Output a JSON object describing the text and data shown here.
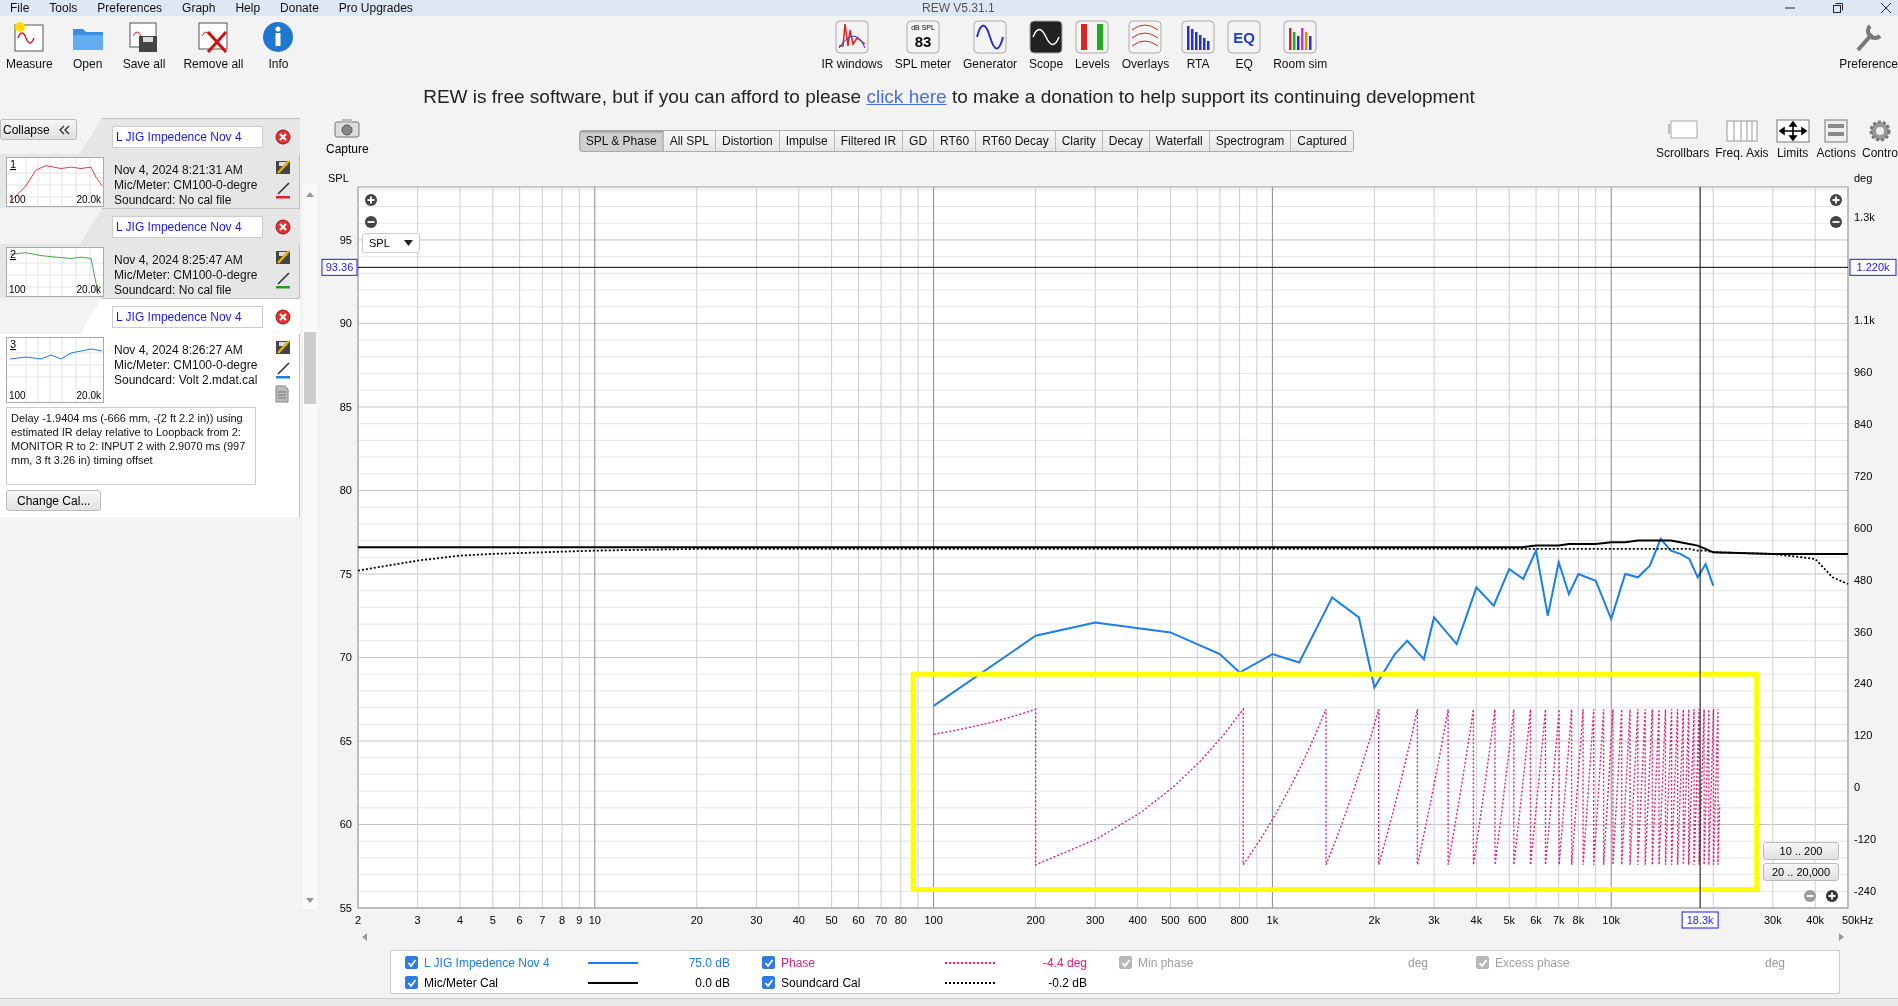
{
  "window": {
    "title": "REW V5.31.1"
  },
  "menu": [
    "File",
    "Tools",
    "Preferences",
    "Graph",
    "Help",
    "Donate",
    "Pro Upgrades"
  ],
  "toolbar_left": [
    {
      "label": "Measure",
      "kind": "measure"
    },
    {
      "label": "Open",
      "kind": "open"
    },
    {
      "label": "Save all",
      "kind": "save"
    },
    {
      "label": "Remove all",
      "kind": "remove"
    },
    {
      "label": "Info",
      "kind": "info"
    }
  ],
  "toolbar_center": [
    {
      "label": "IR windows",
      "kind": "ir"
    },
    {
      "label": "SPL meter",
      "kind": "meter",
      "badge_top": "dB SPL",
      "badge_value": "83"
    },
    {
      "label": "Generator",
      "kind": "generator"
    },
    {
      "label": "Scope",
      "kind": "scope"
    },
    {
      "label": "Levels",
      "kind": "levels"
    },
    {
      "label": "Overlays",
      "kind": "overlays"
    },
    {
      "label": "RTA",
      "kind": "rta"
    },
    {
      "label": "EQ",
      "kind": "eq",
      "badge_value": "EQ"
    },
    {
      "label": "Room sim",
      "kind": "roomsim"
    }
  ],
  "toolbar_right": [
    {
      "label": "Preference",
      "kind": "wrench"
    }
  ],
  "donation": {
    "before": "REW is free software, but if you can afford to please ",
    "link": "click here",
    "after": " to make a donation to help support its continuing development"
  },
  "panel": {
    "collapse": "Collapse",
    "measurements": [
      {
        "index": "1",
        "name": "L JIG Impedence Nov 4",
        "color": "#e02020",
        "date": "Nov 4, 2024 8:21:31 AM",
        "mic": "Mic/Meter: CM100-0-degre",
        "soundcard": "Soundcard: No cal file",
        "axis_low": "100",
        "axis_high": "20.0k",
        "selected": false,
        "expanded": false
      },
      {
        "index": "2",
        "name": "L JIG Impedence Nov 4",
        "color": "#2a9a2a",
        "date": "Nov 4, 2024 8:25:47 AM",
        "mic": "Mic/Meter: CM100-0-degre",
        "soundcard": "Soundcard: No cal file",
        "axis_low": "100",
        "axis_high": "20.0k",
        "selected": false,
        "expanded": false
      },
      {
        "index": "3",
        "name": "L JIG Impedence Nov 4",
        "color": "#1a7fe8",
        "date": "Nov 4, 2024 8:26:27 AM",
        "mic": "Mic/Meter: CM100-0-degre",
        "soundcard": "Soundcard: Volt 2.mdat.cal",
        "axis_low": "100",
        "axis_high": "20.0k",
        "selected": true,
        "expanded": true,
        "delay_info": "Delay -1.9404 ms (-666 mm, -(2 ft 2.2 in)) using estimated IR delay relative to Loopback from 2: MONITOR R to 2: INPUT 2 with 2.9070 ms (997 mm, 3 ft 3.26 in) timing offset",
        "button": "Change Cal..."
      }
    ]
  },
  "capture": "Capture",
  "graph_tabs": [
    {
      "label": "SPL & Phase",
      "selected": true
    },
    {
      "label": "All SPL",
      "selected": false
    },
    {
      "label": "Distortion",
      "selected": false
    },
    {
      "label": "Impulse",
      "selected": false
    },
    {
      "label": "Filtered IR",
      "selected": false
    },
    {
      "label": "GD",
      "selected": false
    },
    {
      "label": "RT60",
      "selected": false
    },
    {
      "label": "RT60 Decay",
      "selected": false
    },
    {
      "label": "Clarity",
      "selected": false
    },
    {
      "label": "Decay",
      "selected": false
    },
    {
      "label": "Waterfall",
      "selected": false
    },
    {
      "label": "Spectrogram",
      "selected": false
    },
    {
      "label": "Captured",
      "selected": false
    }
  ],
  "graph_tools": [
    {
      "label": "Scrollbars",
      "kind": "scrollbars"
    },
    {
      "label": "Freq. Axis",
      "kind": "freq"
    },
    {
      "label": "Limits",
      "kind": "limits"
    },
    {
      "label": "Actions",
      "kind": "actions"
    },
    {
      "label": "Contro",
      "kind": "controls"
    }
  ],
  "graph": {
    "dropdown": "SPL",
    "range_buttons": [
      "10 .. 200",
      "20 .. 20,000"
    ],
    "deg_axis": {
      "title": "deg",
      "ticks": [
        "1.3k",
        "1.1k",
        "960",
        "840",
        "720",
        "600",
        "480",
        "360",
        "240",
        "120",
        "0",
        "-120",
        "-240"
      ]
    },
    "spl_axis": {
      "title": "SPL",
      "ticks": [
        "95",
        "90",
        "85",
        "80",
        "75",
        "70",
        "65",
        "60",
        "55"
      ]
    },
    "freq_axis": [
      "2",
      "3",
      "4",
      "5",
      "6",
      "7",
      "8",
      "9",
      "10",
      "20",
      "30",
      "40",
      "50",
      "60",
      "70",
      "80",
      "100",
      "200",
      "300",
      "400",
      "500",
      "600",
      "800",
      "1k",
      "2k",
      "3k",
      "4k",
      "5k",
      "6k",
      "7k",
      "8k",
      "10k",
      "30k",
      "40k",
      "50kHz"
    ],
    "cursor": {
      "spl": "93.36",
      "deg": "1.220k",
      "frequency": "18.3k"
    },
    "highlight": {
      "color": "#ffff00"
    }
  },
  "legend": {
    "rows": [
      [
        {
          "kind": "solid",
          "label": "L JIG Impedence Nov 4",
          "color": "#1a7fe8",
          "value": "75.0 dB",
          "checked": true
        },
        {
          "kind": "dotted",
          "label": "Phase",
          "color": "#e0207a",
          "value": "-4.4 deg",
          "checked": true
        },
        {
          "kind": "option",
          "label": "Min phase",
          "unit": "deg",
          "checked": true,
          "disabled": true
        },
        {
          "kind": "option",
          "label": "Excess phase",
          "unit": "deg",
          "checked": true,
          "disabled": true
        }
      ],
      [
        {
          "kind": "solid",
          "label": "Mic/Meter Cal",
          "color": "#000000",
          "value": "0.0 dB",
          "checked": true
        },
        {
          "kind": "dotted",
          "label": "Soundcard Cal",
          "color": "#000000",
          "value": "-0.2 dB",
          "checked": true
        }
      ]
    ]
  }
}
